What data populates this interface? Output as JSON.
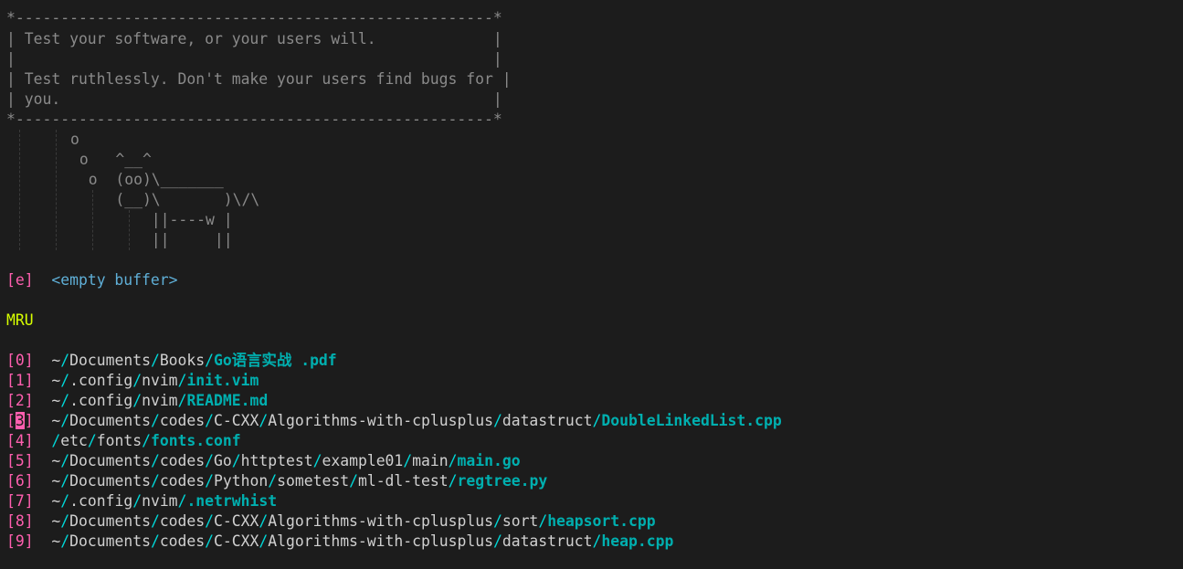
{
  "header": {
    "box_top": "*-----------------------------------------------------*",
    "box_line_1": "| Test your software, or your users will.             |",
    "box_line_2": "|                                                     |",
    "box_line_3": "| Test ruthlessly. Don't make your users find bugs for |",
    "box_line_4": "| you.                                                |",
    "box_bottom": "*-----------------------------------------------------*",
    "cow": [
      "o",
      " o   ^__^",
      "  o  (oo)\\_______",
      "     (__)\\       )\\/\\",
      "         ||----w |",
      "         ||     ||"
    ]
  },
  "empty_buffer": {
    "index": "[e]",
    "label": "<empty buffer>"
  },
  "mru": {
    "title": "MRU",
    "items": [
      {
        "index": "0",
        "dirs": [
          "~",
          "Documents",
          "Books"
        ],
        "file": "Go语言实战 .pdf"
      },
      {
        "index": "1",
        "dirs": [
          "~",
          ".config",
          "nvim"
        ],
        "file": "init.vim"
      },
      {
        "index": "2",
        "dirs": [
          "~",
          ".config",
          "nvim"
        ],
        "file": "README.md"
      },
      {
        "index": "3",
        "dirs": [
          "~",
          "Documents",
          "codes",
          "C-CXX",
          "Algorithms-with-cplusplus",
          "datastruct"
        ],
        "file": "DoubleLinkedList.cpp"
      },
      {
        "index": "4",
        "dirs": [
          "",
          "etc",
          "fonts"
        ],
        "file": "fonts.conf"
      },
      {
        "index": "5",
        "dirs": [
          "~",
          "Documents",
          "codes",
          "Go",
          "httptest",
          "example01",
          "main"
        ],
        "file": "main.go"
      },
      {
        "index": "6",
        "dirs": [
          "~",
          "Documents",
          "codes",
          "Python",
          "sometest",
          "ml-dl-test"
        ],
        "file": "regtree.py"
      },
      {
        "index": "7",
        "dirs": [
          "~",
          ".config",
          "nvim"
        ],
        "file": ".netrwhist"
      },
      {
        "index": "8",
        "dirs": [
          "~",
          "Documents",
          "codes",
          "C-CXX",
          "Algorithms-with-cplusplus",
          "sort"
        ],
        "file": "heapsort.cpp"
      },
      {
        "index": "9",
        "dirs": [
          "~",
          "Documents",
          "codes",
          "C-CXX",
          "Algorithms-with-cplusplus",
          "datastruct"
        ],
        "file": "heap.cpp"
      }
    ]
  },
  "cursor_item": "3"
}
